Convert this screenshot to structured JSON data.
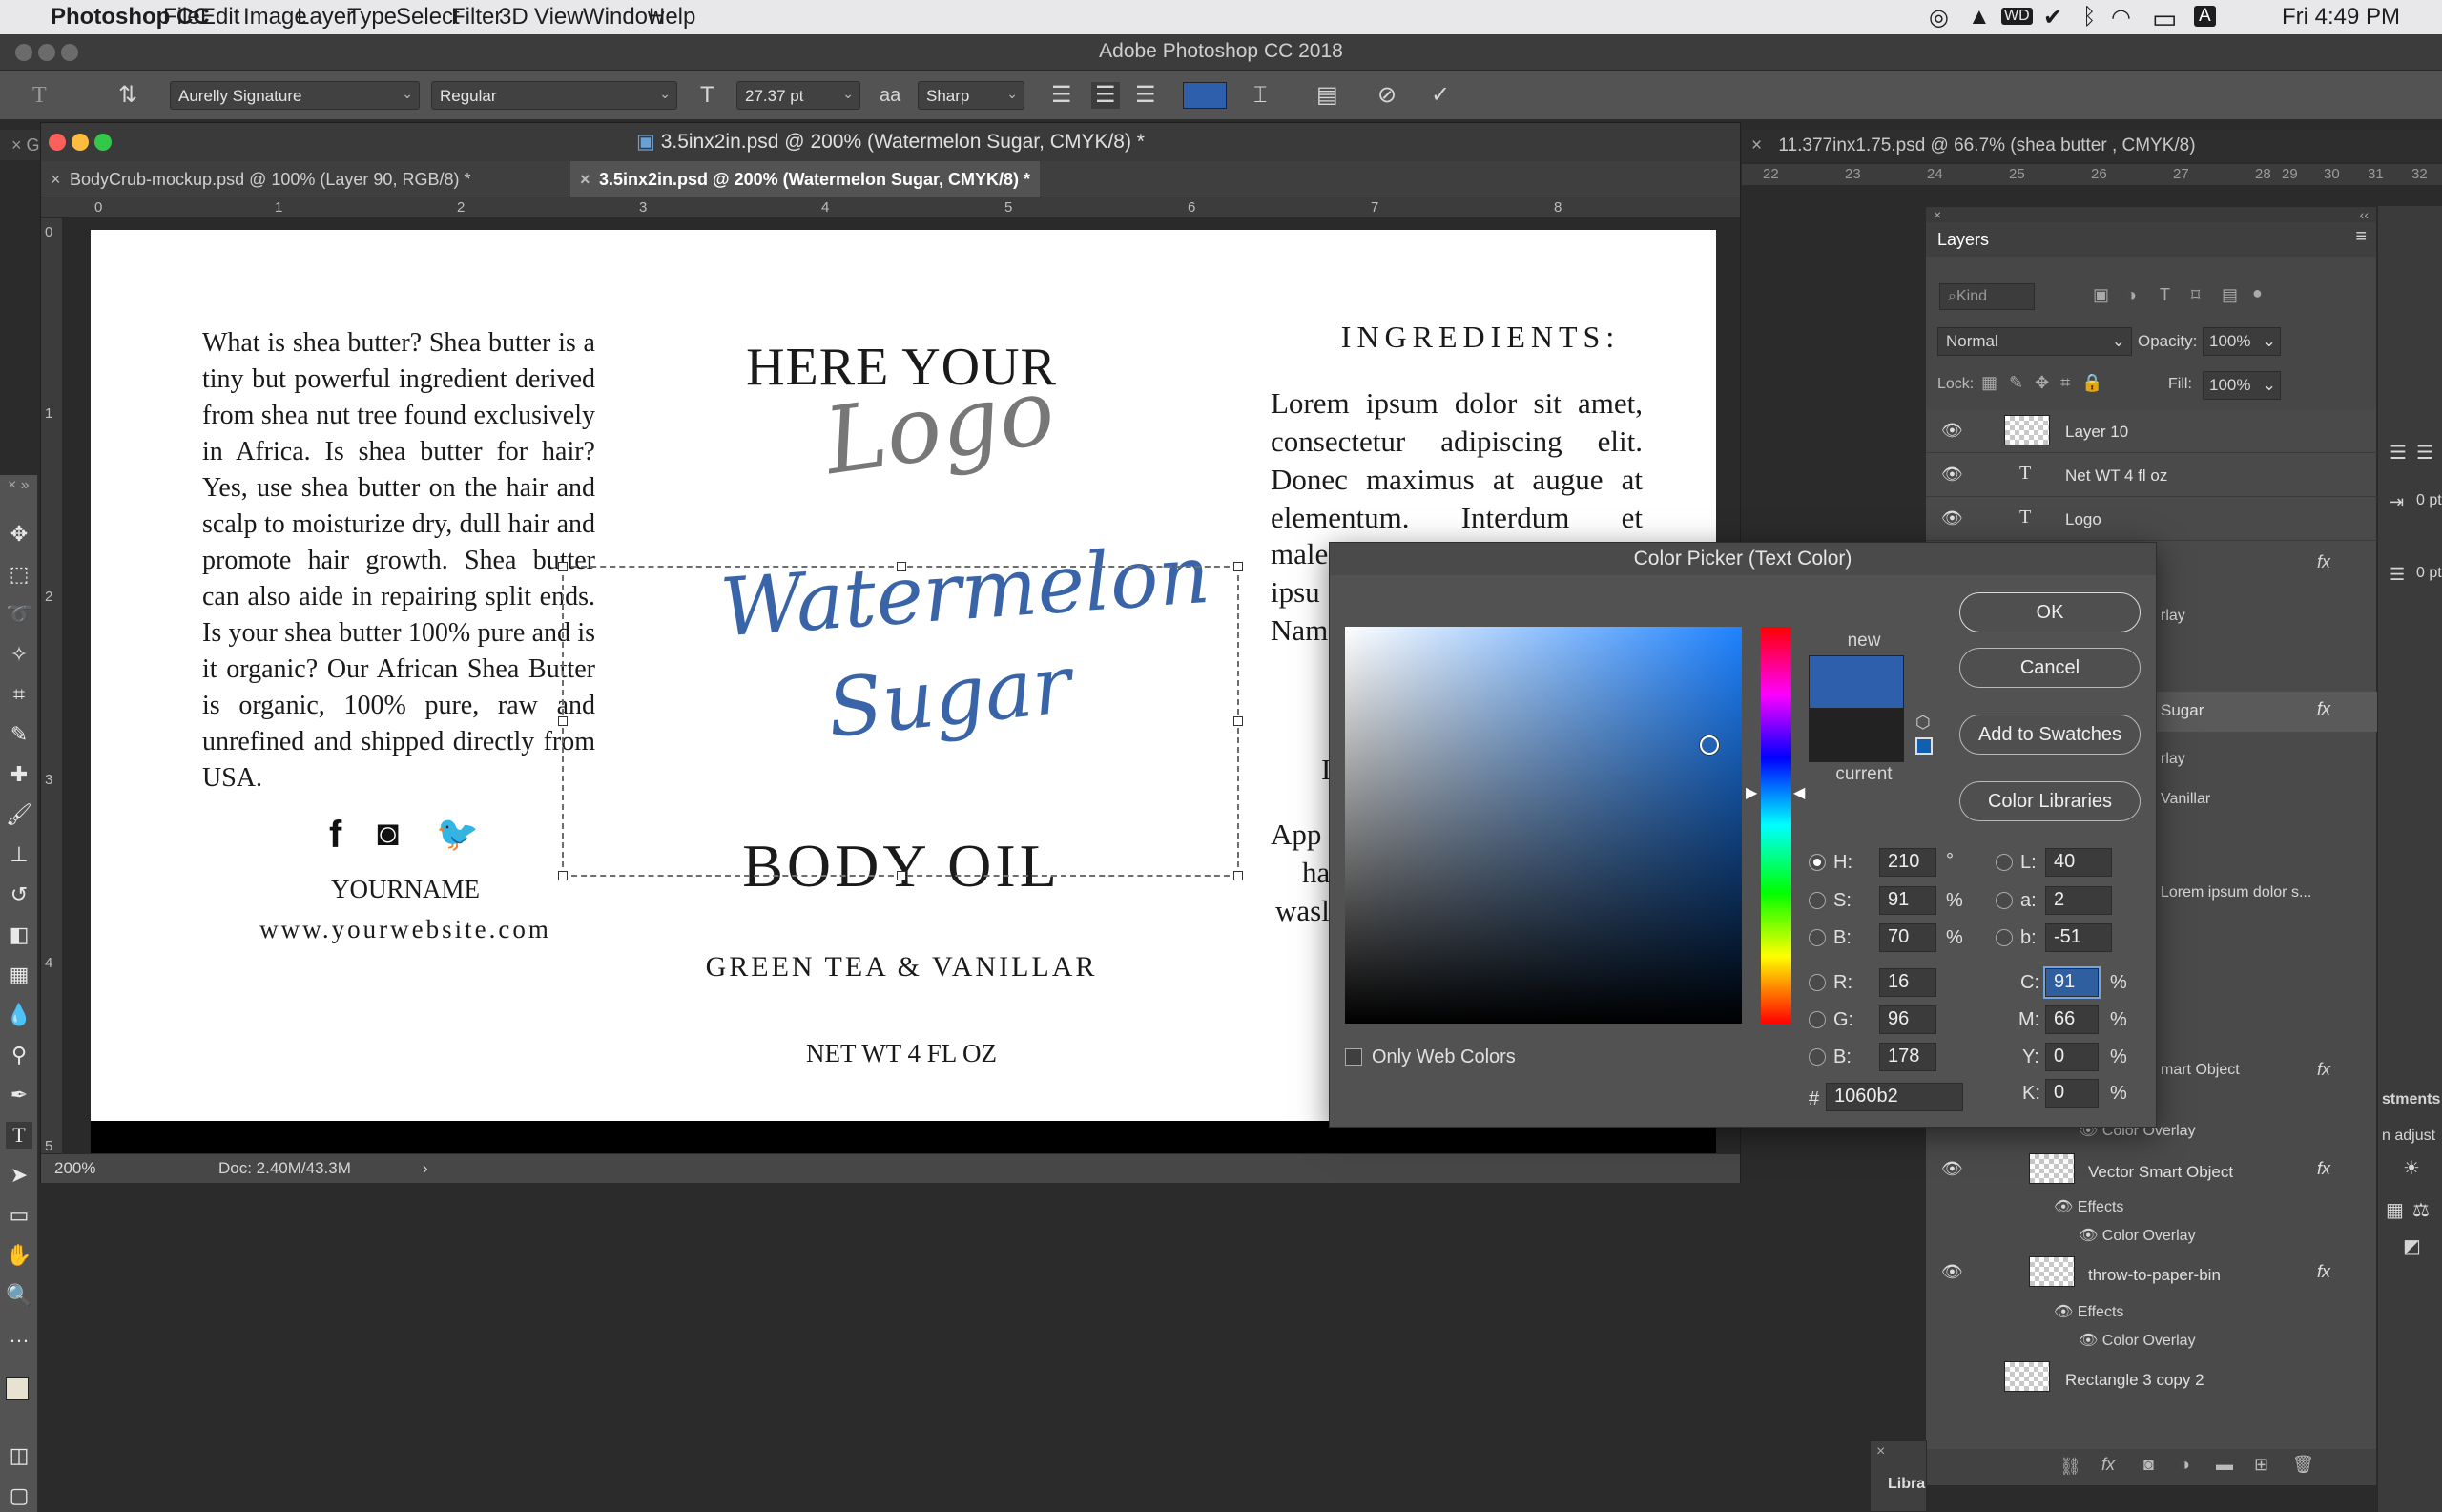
{
  "menubar": {
    "app_name": "Photoshop CC",
    "items": [
      "File",
      "Edit",
      "Image",
      "Layer",
      "Type",
      "Select",
      "Filter",
      "3D",
      "View",
      "Window",
      "Help"
    ],
    "clock": "Fri 4:49 PM"
  },
  "app": {
    "title": "Adobe Photoshop CC 2018"
  },
  "options": {
    "font_family": "Aurelly Signature",
    "font_style": "Regular",
    "font_size": "27.37 pt",
    "antialias_icon": "aa",
    "antialias": "Sharp",
    "color_swatch": "#2e5fac"
  },
  "document": {
    "title": "3.5inx2in.psd @ 200% (Watermelon Sugar, CMYK/8) *",
    "tabs": [
      {
        "label": "BodyCrub-mockup.psd @ 100% (Layer 90, RGB/8) *"
      },
      {
        "label": "3.5inx2in.psd @ 200% (Watermelon Sugar, CMYK/8) *"
      }
    ],
    "ruler_top": [
      "0",
      "1",
      "2",
      "3",
      "4",
      "5",
      "6",
      "7",
      "8"
    ],
    "ruler_left": [
      "0",
      "1",
      "2",
      "3",
      "4",
      "5"
    ],
    "zoom": "200%",
    "doc_size": "Doc: 2.40M/43.3M"
  },
  "second_doc": {
    "title": "11.377inx1.75.psd @ 66.7% (shea butter , CMYK/8)",
    "ruler": [
      "22",
      "23",
      "24",
      "25",
      "26",
      "27",
      "28",
      "29",
      "30",
      "31",
      "32"
    ]
  },
  "label": {
    "shea_text": "What is shea butter? Shea butter is a tiny but powerful ingredient derived from shea nut tree found exclusively in Africa. Is shea butter for hair? Yes, use shea butter on the hair and scalp to moisturize dry, dull hair and promote hair growth. Shea butter can also aide in repairing split ends. Is your shea butter 100% pure and is it organic? Our African Shea Butter is organic, 100% pure, raw and unrefined and shipped directly from USA.",
    "social": [
      "f",
      "◙",
      "🐦"
    ],
    "yourname": "YOURNAME",
    "website": "www.yourwebsite.com",
    "logo_top": "HERE YOUR",
    "logo_script": "Logo",
    "product_line1": "Watermelon",
    "product_line2": "Sugar",
    "body_oil": "BODY OIL",
    "scent": "GREEN TEA & VANILLAR",
    "net_wt": "NET WT 4 FL OZ",
    "ingredients_title": "INGREDIENTS:",
    "ingredients_text": "Lorem ipsum dolor sit amet, consectetur adipiscing elit. Donec maximus at augue at elementum. Interdum et",
    "partial_lines": [
      "male",
      "ipsu",
      "Nam",
      "I",
      "App",
      "ha",
      "wasl"
    ]
  },
  "color_picker": {
    "title": "Color Picker (Text Color)",
    "new_label": "new",
    "current_label": "current",
    "new_color": "#2e5fac",
    "current_color": "#222222",
    "buttons": {
      "ok": "OK",
      "cancel": "Cancel",
      "add": "Add to Swatches",
      "libraries": "Color Libraries"
    },
    "only_web": "Only Web Colors",
    "fields": {
      "H": "210",
      "H_unit": "°",
      "S": "91",
      "S_unit": "%",
      "B": "70",
      "B_unit": "%",
      "R": "16",
      "G": "96",
      "Bv": "178",
      "L": "40",
      "a": "2",
      "b": "-51",
      "C": "91",
      "M": "66",
      "Y": "0",
      "K": "0",
      "hex": "1060b2",
      "hash": "#",
      "pct": "%"
    }
  },
  "layers": {
    "title": "Layers",
    "kind": "Kind",
    "blend": "Normal",
    "opacity_label": "Opacity:",
    "opacity": "100%",
    "lock_label": "Lock:",
    "fill_label": "Fill:",
    "fill": "100%",
    "rows": {
      "layer10": "Layer 10",
      "netwt": "Net WT 4 fl oz",
      "logo": "Logo",
      "rlay1": "rlay",
      "sugar": "Sugar",
      "rlay2": "rlay",
      "vanillar": "Vanillar",
      "lorem": "Lorem ipsum dolor s...",
      "smart_obj_partial": "mart Object",
      "effects": "Effects",
      "color_overlay": "Color Overlay",
      "vso": "Vector Smart Object",
      "throw": "throw-to-paper-bin",
      "rect": "Rectangle 3 copy 2",
      "fx": "fx",
      "T": "T"
    }
  },
  "right_strip": {
    "adj_title": "stments",
    "adj_sub": "n adjust",
    "pt1": "0 pt",
    "pt2": "0 pt",
    "libra": "Libra"
  }
}
